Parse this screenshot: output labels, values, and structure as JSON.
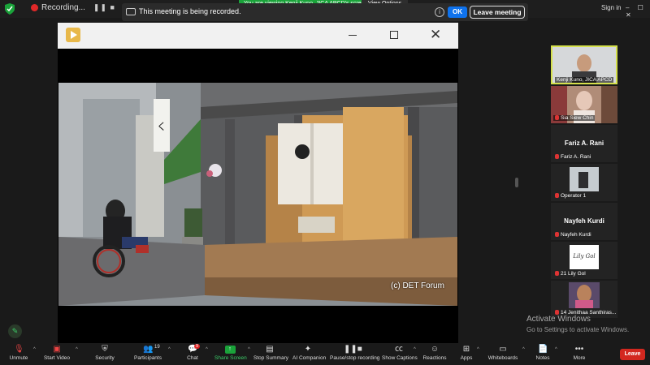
{
  "topbar": {
    "recording_label": "Recording...",
    "viewing_banner": "You are viewing Kenji Kuno, JICA APCD's screen",
    "view_options": "View Options",
    "sign_in": "Sign in",
    "window_controls": "– ☐ ✕"
  },
  "record_notice": {
    "text": "This meeting is being recorded.",
    "info_icon": "i",
    "ok_label": "OK",
    "leave_label": "Leave meeting"
  },
  "player": {
    "credit": "(c) DET Forum",
    "close_glyph": "✕"
  },
  "participants": [
    {
      "name": "Kenji Kuno, JICA APCD",
      "type": "video"
    },
    {
      "name": "Sia Siew Chin",
      "type": "video"
    },
    {
      "name": "Fariz A. Rani",
      "type": "name"
    },
    {
      "name": "Operator 1",
      "type": "video"
    },
    {
      "name": "Nayfeh Kurdi",
      "type": "name"
    },
    {
      "name": "21 Lily Gol",
      "type": "logo",
      "logo_text": "Lily Gol"
    },
    {
      "name": "14 Jenithaa Santhiras...",
      "type": "video"
    }
  ],
  "watermark": {
    "line1": "Activate Windows",
    "line2": "Go to Settings to activate Windows."
  },
  "toolbar": {
    "unmute": "Unmute",
    "start_video": "Start Video",
    "security": "Security",
    "participants": "Participants",
    "participants_count": "19",
    "chat": "Chat",
    "chat_badge": "9",
    "share_screen": "Share Screen",
    "stop_summary": "Stop Summary",
    "ai_companion": "AI Companion",
    "pause_stop": "Pause/stop recording",
    "show_captions": "Show Captions",
    "reactions": "Reactions",
    "apps": "Apps",
    "whiteboards": "Whiteboards",
    "notes": "Notes",
    "more": "More",
    "leave": "Leave"
  },
  "colors": {
    "green": "#1aa33a",
    "blue": "#0e72ed",
    "red": "#d3281f",
    "active_border": "#d5e04c"
  }
}
